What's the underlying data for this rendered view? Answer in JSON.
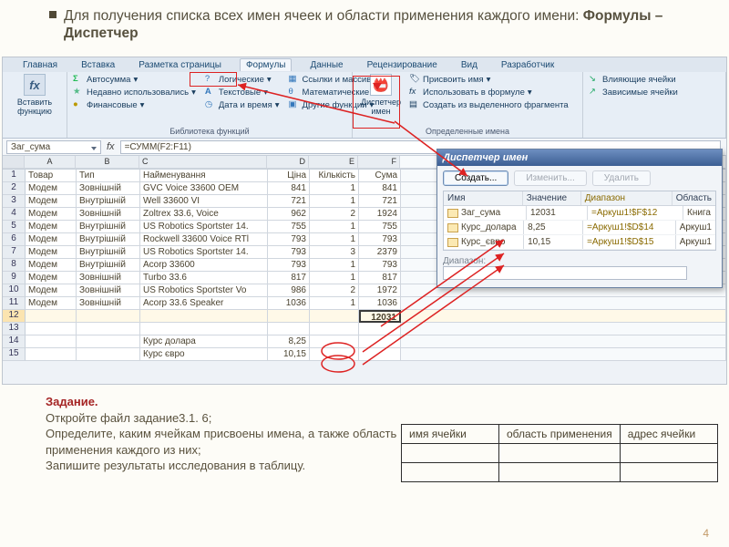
{
  "intro": {
    "prefix_plain": "Для получения списка всех имен ячеек и области применения каждого имени: ",
    "bold": "Формулы – Диспетчер "
  },
  "ribbon": {
    "tabs": [
      "Главная",
      "Вставка",
      "Разметка страницы",
      "Формулы",
      "Данные",
      "Рецензирование",
      "Вид",
      "Разработчик"
    ],
    "active_tab_index": 3,
    "group1": {
      "big": "Вставить функцию",
      "a": "Автосумма",
      "b": "Недавно использовались",
      "c": "Финансовые",
      "d": "Логические",
      "e": "Текстовые",
      "f": "Дата и время",
      "g": "Ссылки и массивы",
      "h": "Математические",
      "i": "Другие функции",
      "title": "Библиотека функций"
    },
    "group2": {
      "big": "Диспетчер имен",
      "a": "Присвоить имя",
      "b": "Использовать в формуле",
      "c": "Создать из выделенного фрагмента",
      "title": "Определенные имена"
    },
    "group3": {
      "a": "Влияющие ячейки",
      "b": "Зависимые ячейки"
    }
  },
  "name_box": "Заг_сума",
  "formula": "=СУММ(F2:F11)",
  "cols": [
    "A",
    "B",
    "C",
    "D",
    "E",
    "F"
  ],
  "headers": [
    "Товар",
    "Тип",
    "Найменування",
    "Ціна",
    "Кількість",
    "Сума"
  ],
  "rows": [
    [
      "Модем",
      "Зовнішній",
      "GVC Voice 33600 OEM",
      "841",
      "1",
      "841"
    ],
    [
      "Модем",
      "Внутрішній",
      "Well 33600 VI",
      "721",
      "1",
      "721"
    ],
    [
      "Модем",
      "Зовнішній",
      "Zoltrex 33.6, Voice",
      "962",
      "2",
      "1924"
    ],
    [
      "Модем",
      "Внутрішній",
      "US Robotics Sportster 14.",
      "755",
      "1",
      "755"
    ],
    [
      "Модем",
      "Внутрішній",
      "Rockwell 33600 Voice RTl",
      "793",
      "1",
      "793"
    ],
    [
      "Модем",
      "Внутрішній",
      "US Robotics Sportster 14.",
      "793",
      "3",
      "2379"
    ],
    [
      "Модем",
      "Внутрішній",
      "Acorp 33600",
      "793",
      "1",
      "793"
    ],
    [
      "Модем",
      "Зовнішній",
      "Turbo 33.6",
      "817",
      "1",
      "817"
    ],
    [
      "Модем",
      "Зовнішній",
      "US Robotics Sportster Vo",
      "986",
      "2",
      "1972"
    ],
    [
      "Модем",
      "Зовнішній",
      "Acorp 33.6 Speaker",
      "1036",
      "1",
      "1036"
    ]
  ],
  "total": "12031",
  "extra": [
    {
      "row": "14",
      "label": "Курс долара",
      "val": "8,25"
    },
    {
      "row": "15",
      "label": "Курс євро",
      "val": "10,15"
    }
  ],
  "nm": {
    "title": "Диспетчер имен",
    "create": "Создать...",
    "edit": "Изменить...",
    "del": "Удалить",
    "h": [
      "Имя",
      "Значение",
      "Диапазон",
      "Область"
    ],
    "rows": [
      {
        "n": "Заг_сума",
        "v": "12031",
        "r": "=Аркуш1!$F$12",
        "s": "Книга"
      },
      {
        "n": "Курс_долара",
        "v": "8,25",
        "r": "=Аркуш1!$D$14",
        "s": "Аркуш1"
      },
      {
        "n": "Курс_євро",
        "v": "10,15",
        "r": "=Аркуш1!$D$15",
        "s": "Аркуш1"
      }
    ],
    "range_label": "Диапазон:"
  },
  "task": {
    "title": "Задание.",
    "l1": "Откройте файл задание3.1. 6;",
    "l2": "Определите, каким ячейкам присвоены имена, а также область применения каждого из них;",
    "l3": "Запишите результаты исследования в таблицу."
  },
  "answer_table": {
    "h1": "имя ячейки",
    "h2": "область применения",
    "h3": "адрес ячейки"
  },
  "page_num": "4"
}
